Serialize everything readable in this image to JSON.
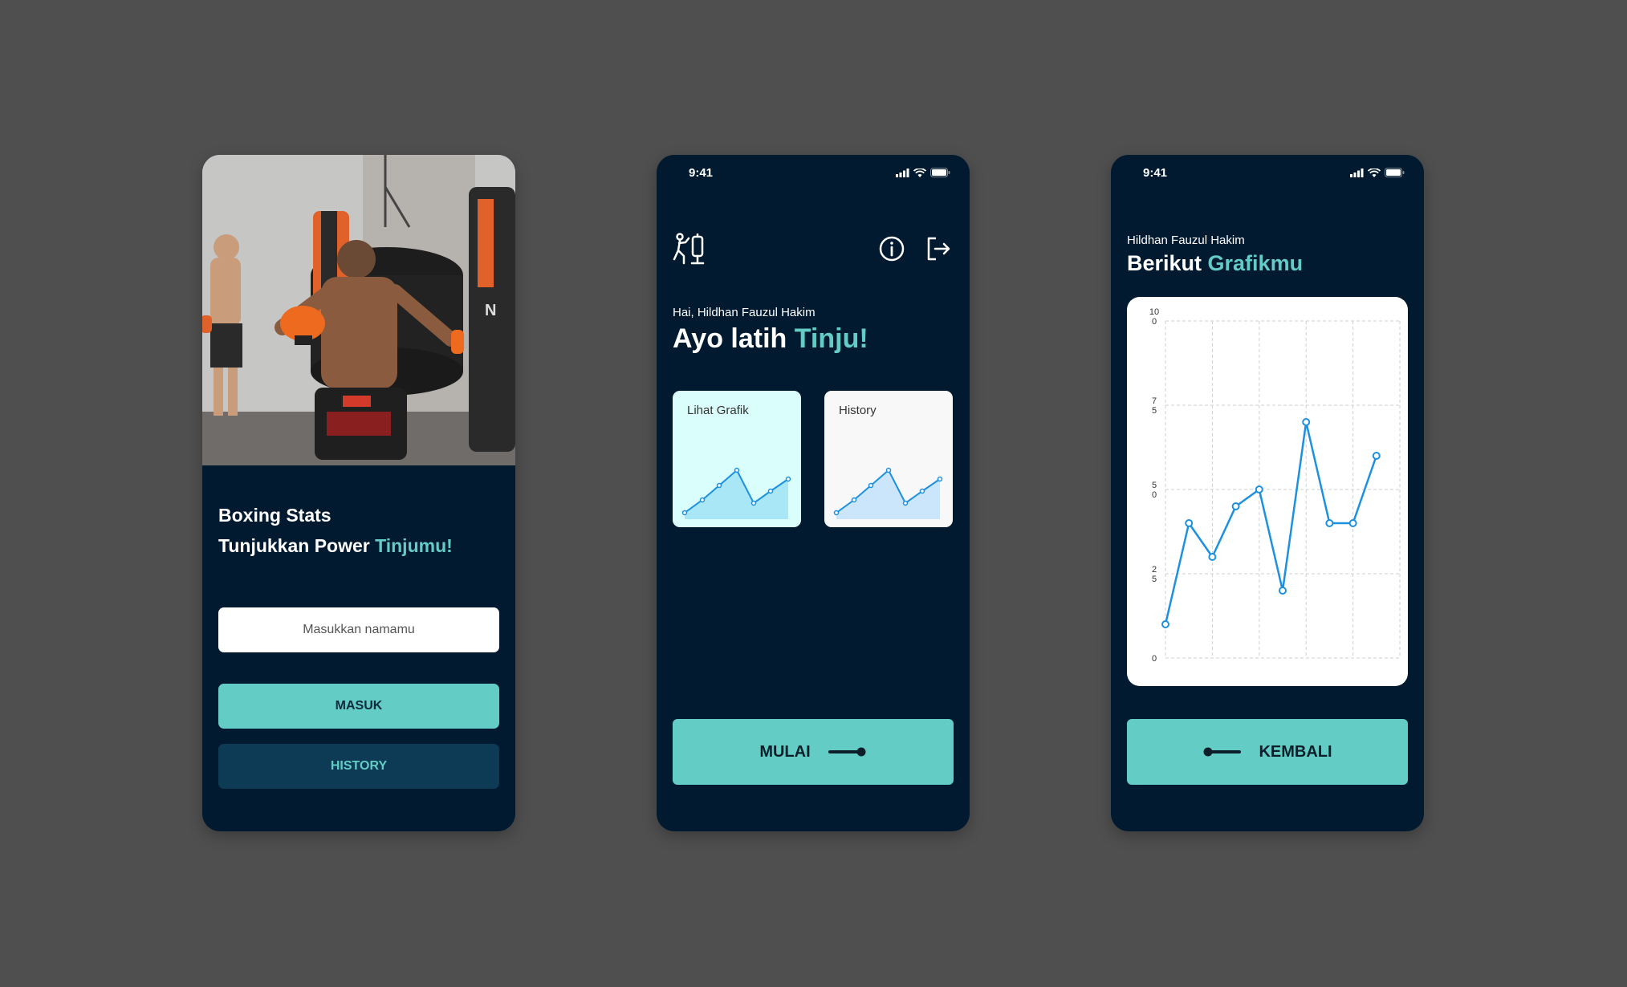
{
  "login_screen": {
    "title_line1": "Boxing Stats",
    "title_line2_prefix": "Tunjukkan Power ",
    "title_line2_accent": "Tinjumu!",
    "name_placeholder": "Masukkan namamu",
    "masuk_label": "MASUK",
    "history_label": "HISTORY"
  },
  "home_screen": {
    "status_time": "9:41",
    "greeting": "Hai, Hildhan Fauzul Hakim",
    "headline_prefix": "Ayo latih ",
    "headline_accent": "Tinju!",
    "card_grafik_label": "Lihat Grafik",
    "card_history_label": "History",
    "mulai_label": "MULAI"
  },
  "graph_screen": {
    "status_time": "9:41",
    "user_name": "Hildhan Fauzul Hakim",
    "title_prefix": "Berikut ",
    "title_accent": "Grafikmu",
    "kembali_label": "KEMBALI"
  },
  "icons": [
    "boxer-punching-bag-icon",
    "info-icon",
    "logout-icon",
    "signal-icon",
    "wifi-icon",
    "battery-icon",
    "slider-arrow-right-icon",
    "slider-arrow-left-icon"
  ],
  "colors": {
    "background": "#4f4f4f",
    "phone_bg": "#011a30",
    "accent": "#63ccc5",
    "history_button": "#0d3b55",
    "chart_line": "#1e90e0",
    "card_grafik_bg": "#d9fefb"
  },
  "chart_data": {
    "type": "line",
    "x": [
      0,
      1,
      2,
      3,
      4,
      5,
      6,
      7,
      8,
      9,
      10
    ],
    "values": [
      10,
      40,
      30,
      45,
      50,
      20,
      70,
      40,
      40,
      60
    ],
    "ytick_labels": [
      "0",
      "25",
      "50",
      "75",
      "100"
    ],
    "ylim": [
      0,
      100
    ],
    "grid": true,
    "series": [
      {
        "values": [
          10,
          40,
          30,
          45,
          50,
          20,
          70,
          40,
          40,
          60
        ]
      }
    ]
  }
}
